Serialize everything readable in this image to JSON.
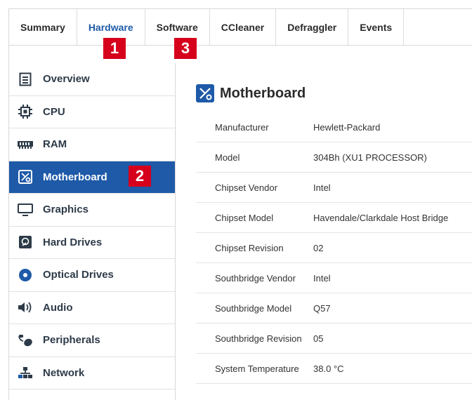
{
  "tabs": [
    {
      "label": "Summary"
    },
    {
      "label": "Hardware"
    },
    {
      "label": "Software"
    },
    {
      "label": "CCleaner"
    },
    {
      "label": "Defraggler"
    },
    {
      "label": "Events"
    }
  ],
  "annotations": {
    "one": "1",
    "two": "2",
    "three": "3"
  },
  "annotation_color": "#d6001c",
  "accent_color": "#1e5aa8",
  "sidebar": {
    "items": [
      {
        "label": "Overview",
        "icon": "overview-icon"
      },
      {
        "label": "CPU",
        "icon": "cpu-icon"
      },
      {
        "label": "RAM",
        "icon": "ram-icon"
      },
      {
        "label": "Motherboard",
        "icon": "motherboard-icon",
        "selected": true
      },
      {
        "label": "Graphics",
        "icon": "monitor-icon"
      },
      {
        "label": "Hard Drives",
        "icon": "hard-drive-icon"
      },
      {
        "label": "Optical Drives",
        "icon": "optical-disc-icon"
      },
      {
        "label": "Audio",
        "icon": "speaker-icon"
      },
      {
        "label": "Peripherals",
        "icon": "peripherals-icon"
      },
      {
        "label": "Network",
        "icon": "network-icon"
      }
    ]
  },
  "main": {
    "title": "Motherboard",
    "rows": [
      {
        "key": "Manufacturer",
        "value": "Hewlett-Packard"
      },
      {
        "key": "Model",
        "value": "304Bh (XU1 PROCESSOR)"
      },
      {
        "key": "Chipset Vendor",
        "value": "Intel"
      },
      {
        "key": "Chipset Model",
        "value": "Havendale/Clarkdale Host Bridge"
      },
      {
        "key": "Chipset Revision",
        "value": "02"
      },
      {
        "key": "Southbridge Vendor",
        "value": "Intel"
      },
      {
        "key": "Southbridge Model",
        "value": "Q57"
      },
      {
        "key": "Southbridge Revision",
        "value": "05"
      },
      {
        "key": "System Temperature",
        "value": "38.0 °C"
      }
    ]
  }
}
